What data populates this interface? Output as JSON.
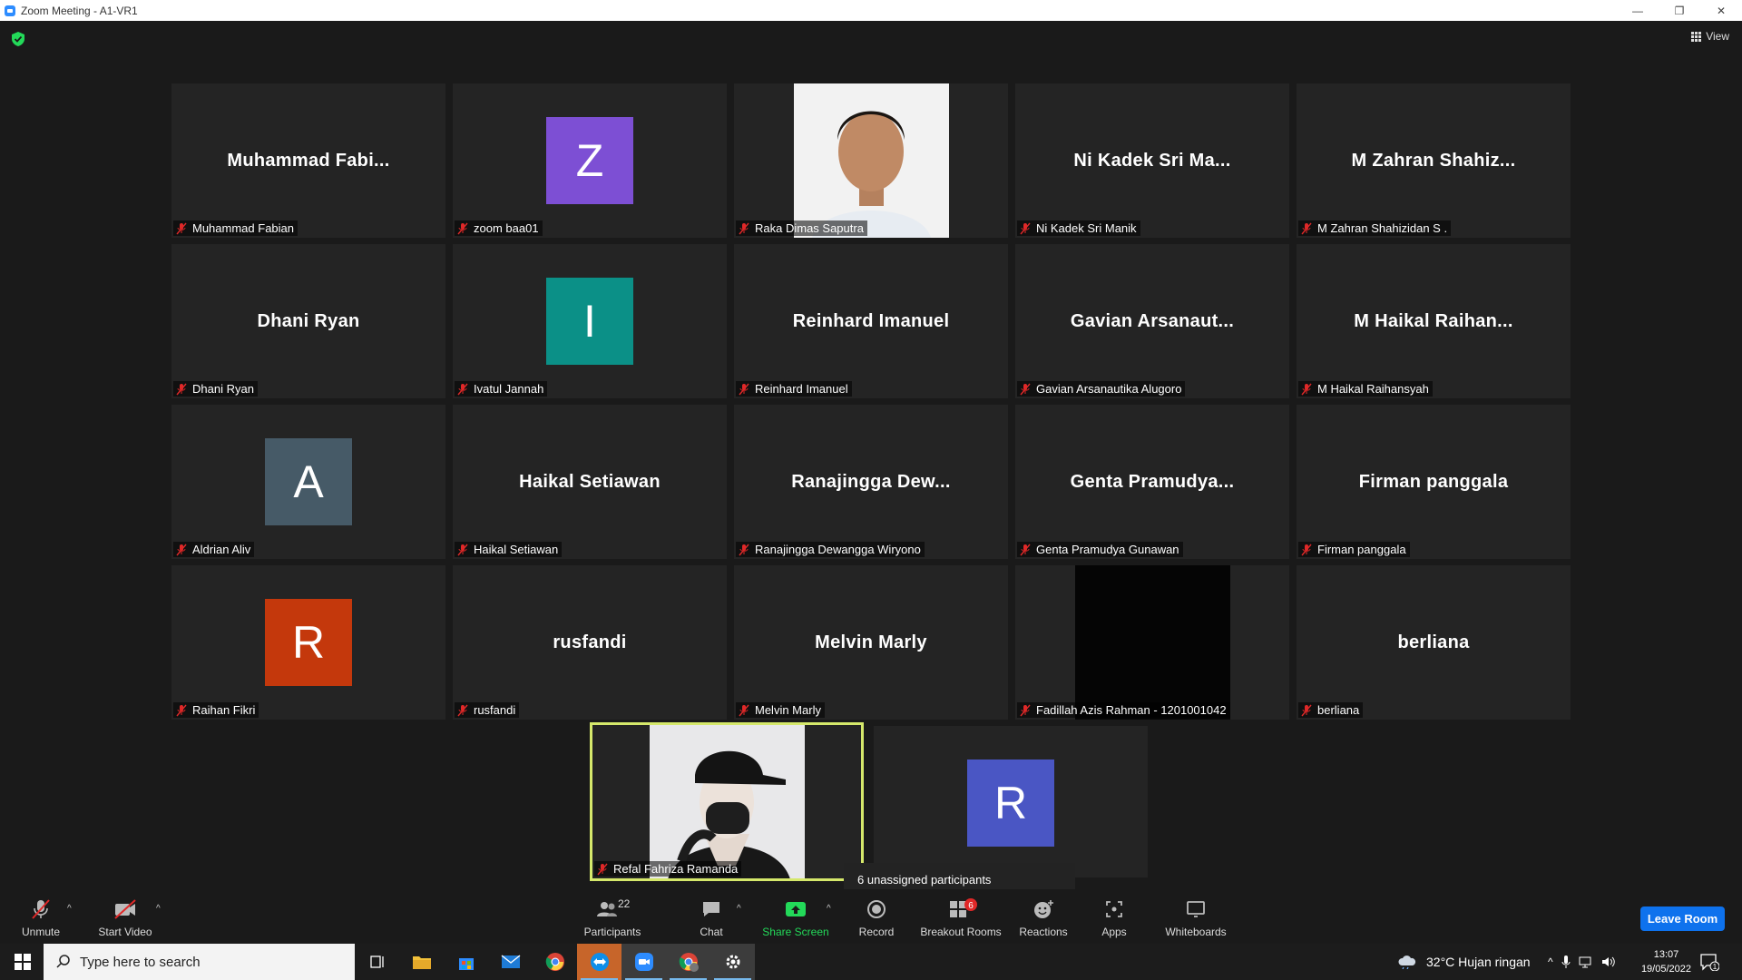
{
  "window": {
    "title": "Zoom Meeting - A1-VR1",
    "minimize": "—",
    "restore": "❐",
    "close": "✕"
  },
  "topbar": {
    "view_label": "View"
  },
  "gallery": [
    {
      "big": "Muhammad  Fabi...",
      "name": "Muhammad Fabian"
    },
    {
      "avatar": "Z",
      "avatar_color": "#7d4fd4",
      "name": "zoom baa01"
    },
    {
      "photo": true,
      "name": "Raka Dimas Saputra"
    },
    {
      "big": "Ni Kadek Sri Ma...",
      "name": "Ni Kadek Sri Manik"
    },
    {
      "big": "M  Zahran  Shahiz...",
      "name": "M Zahran Shahizidan S ."
    },
    {
      "big": "Dhani Ryan",
      "name": "Dhani Ryan"
    },
    {
      "avatar": "I",
      "avatar_color": "#0b9087",
      "name": "Ivatul Jannah"
    },
    {
      "big": "Reinhard Imanuel",
      "name": "Reinhard Imanuel"
    },
    {
      "big": "Gavian  Arsanaut...",
      "name": "Gavian Arsanautika Alugoro"
    },
    {
      "big": "M  Haikal  Raihan...",
      "name": "M Haikal Raihansyah"
    },
    {
      "avatar": "A",
      "avatar_color": "#465a67",
      "name": "Aldrian Aliv"
    },
    {
      "big": "Haikal Setiawan",
      "name": "Haikal Setiawan"
    },
    {
      "big": "Ranajingga  Dew...",
      "name": "Ranajingga Dewangga Wiryono"
    },
    {
      "big": "Genta  Pramudya...",
      "name": "Genta Pramudya Gunawan"
    },
    {
      "big": "Firman panggala",
      "name": "Firman panggala"
    },
    {
      "avatar": "R",
      "avatar_color": "#c4380c",
      "name": "Raihan Fikri"
    },
    {
      "big": "rusfandi",
      "name": "rusfandi"
    },
    {
      "big": "Melvin Marly",
      "name": "Melvin Marly"
    },
    {
      "black": true,
      "name": "Fadillah Azis Rahman - 1201001042"
    },
    {
      "big": "berliana",
      "name": "berliana"
    },
    {
      "self": true,
      "name": "Refal Fahriza Ramanda"
    },
    {
      "avatar": "R",
      "avatar_color": "#4a56c4",
      "name": ""
    }
  ],
  "tooltip": "6 unassigned participants",
  "toolbar": {
    "unmute": "Unmute",
    "start_video": "Start Video",
    "participants": "Participants",
    "participants_count": "22",
    "chat": "Chat",
    "share_screen": "Share Screen",
    "record": "Record",
    "breakout_rooms": "Breakout Rooms",
    "breakout_badge": "6",
    "reactions": "Reactions",
    "apps": "Apps",
    "whiteboards": "Whiteboards",
    "leave": "Leave Room"
  },
  "taskbar": {
    "search_placeholder": "Type here to search",
    "weather": "32°C  Hujan ringan",
    "time": "13:07",
    "date": "19/05/2022",
    "notif_count": "1"
  },
  "colors": {
    "accent": "#0e72ed",
    "share_green": "#23d959",
    "badge_red": "#e02828",
    "active_speaker": "#d5e86b"
  }
}
